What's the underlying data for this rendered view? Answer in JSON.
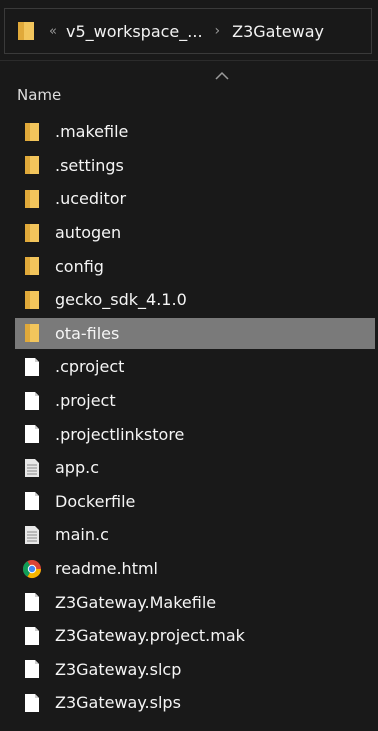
{
  "breadcrumb": {
    "overflow": "«",
    "parent": "v5_workspace_...",
    "separator": "›",
    "current": "Z3Gateway"
  },
  "header": {
    "name_column": "Name"
  },
  "files": [
    {
      "name": ".makefile",
      "type": "folder",
      "icon": "folder-icon"
    },
    {
      "name": ".settings",
      "type": "folder",
      "icon": "folder-icon"
    },
    {
      "name": ".uceditor",
      "type": "folder",
      "icon": "folder-icon"
    },
    {
      "name": "autogen",
      "type": "folder",
      "icon": "folder-icon"
    },
    {
      "name": "config",
      "type": "folder",
      "icon": "folder-icon"
    },
    {
      "name": "gecko_sdk_4.1.0",
      "type": "folder",
      "icon": "folder-icon"
    },
    {
      "name": "ota-files",
      "type": "folder",
      "icon": "folder-icon",
      "selected": true
    },
    {
      "name": ".cproject",
      "type": "file",
      "icon": "file-icon"
    },
    {
      "name": ".project",
      "type": "file",
      "icon": "file-icon"
    },
    {
      "name": ".projectlinkstore",
      "type": "file",
      "icon": "file-icon"
    },
    {
      "name": "app.c",
      "type": "text",
      "icon": "text-file-icon"
    },
    {
      "name": "Dockerfile",
      "type": "file",
      "icon": "file-icon"
    },
    {
      "name": "main.c",
      "type": "text",
      "icon": "text-file-icon"
    },
    {
      "name": "readme.html",
      "type": "html",
      "icon": "chrome-icon"
    },
    {
      "name": "Z3Gateway.Makefile",
      "type": "file",
      "icon": "file-icon"
    },
    {
      "name": "Z3Gateway.project.mak",
      "type": "file",
      "icon": "file-icon"
    },
    {
      "name": "Z3Gateway.slcp",
      "type": "file",
      "icon": "file-icon"
    },
    {
      "name": "Z3Gateway.slps",
      "type": "file",
      "icon": "file-icon"
    }
  ],
  "colors": {
    "background": "#191919",
    "selection": "#7a7a7a",
    "folder": "#f2c55c",
    "file": "#ffffff"
  }
}
